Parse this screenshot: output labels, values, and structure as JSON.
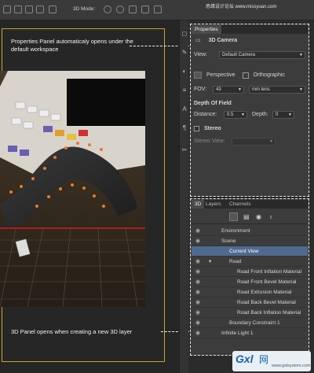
{
  "topbar": {
    "mode_label": "3D Mode:",
    "watermark": "思缘设计论坛 www.missyuan.com"
  },
  "callouts": {
    "properties_note": "Properties Panel automaticaly opens under the default workspace",
    "layer_note": "3D Panel opens when creating a new 3D layer"
  },
  "properties": {
    "tab": "Properties",
    "heading": "3D Camera",
    "view_label": "View:",
    "view_value": "Default Camera",
    "perspective_label": "Perspective",
    "orthographic_label": "Orthographic",
    "fov_label": "FOV:",
    "fov_value": "43",
    "fov_unit": "mm lens",
    "dof_heading": "Depth Of Field",
    "distance_label": "Distance:",
    "distance_value": "0.5",
    "depth_label": "Depth:",
    "depth_value": "0",
    "stereo_label": "Stereo",
    "stereo_view_label": "Stereo View:"
  },
  "panel3d": {
    "tabs": [
      "3D",
      "Layers",
      "Channels"
    ],
    "items": [
      {
        "label": "Environment"
      },
      {
        "label": "Scene"
      },
      {
        "label": "Current View"
      },
      {
        "label": "Road"
      },
      {
        "label": "Road Front Inflation Material"
      },
      {
        "label": "Road Front Bevel Material"
      },
      {
        "label": "Road Extrusion Material"
      },
      {
        "label": "Road Back Bevel Material"
      },
      {
        "label": "Road Back Inflation Material"
      },
      {
        "label": "Boundary Constraint 1"
      },
      {
        "label": "Infinite Light 1"
      }
    ]
  },
  "watermark_logo": {
    "brand": "Gxl",
    "cn": "网",
    "url": "www.gxlsystem.com"
  },
  "colors": {
    "accent_yellow": "#c8a52c",
    "selection_blue": "#4f6a8f",
    "dot_orange": "#e87a2a"
  }
}
